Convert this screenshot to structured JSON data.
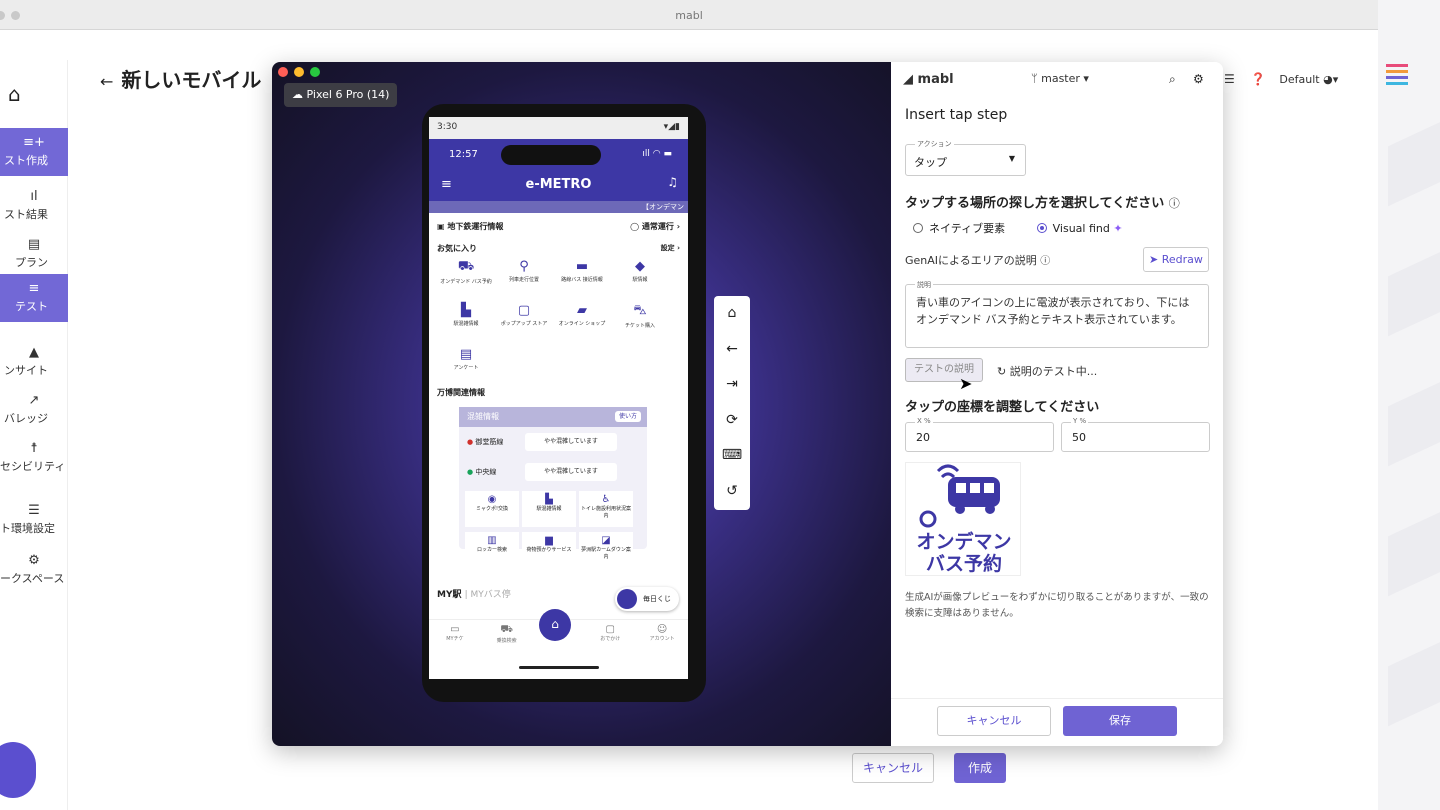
{
  "window": {
    "title": "mabl"
  },
  "leftnav": {
    "items": [
      {
        "label": "スト作成",
        "icon": "add-list-icon",
        "active": true
      },
      {
        "label": "スト結果",
        "icon": "bar-chart-icon",
        "active": false
      },
      {
        "label": "プラン",
        "icon": "calendar-icon",
        "active": false
      },
      {
        "label": "テスト",
        "icon": "list-icon",
        "active": true
      },
      {
        "label": "ンサイト",
        "icon": "bell-icon",
        "active": false
      },
      {
        "label": "バレッジ",
        "icon": "trend-icon",
        "active": false
      },
      {
        "label": "セシビリティ",
        "icon": "accessibility-icon",
        "active": false
      },
      {
        "label": "ト環境設定",
        "icon": "sliders-icon",
        "active": false
      },
      {
        "label": "ークスペース",
        "icon": "gear-icon",
        "active": false
      }
    ]
  },
  "page": {
    "title": "新しいモバイル",
    "cancel_label": "キャンセル",
    "create_label": "作成"
  },
  "emulator": {
    "device_label": "Pixel 6 Pro (14)",
    "phone": {
      "status_time": "3:30",
      "inner_time": "12:57",
      "logo": "-METRO",
      "ticker": "【オンデマン",
      "subway_info": "地下鉄運行情報",
      "normal_op": "通常運行",
      "favorites": "お気に入り",
      "settings": "設定",
      "grid": [
        "オンデマンド バス予約",
        "列車走行位置",
        "路線バス 接近情報",
        "駅情報",
        "駅混雑情報",
        "ポップアップ ストア",
        "オンライン ショップ",
        "チケット購入",
        "アンケート"
      ],
      "expo": "万博関連情報",
      "crowd_title": "混雑情報",
      "crowd_howto": "使い方",
      "lines": [
        {
          "name": "御堂筋線",
          "status": "やや混雑しています"
        },
        {
          "name": "中央線",
          "status": "やや混雑しています"
        }
      ],
      "tiles": [
        "ミャクポ!交換",
        "駅混雑情報",
        "トイレ施設利用状況案内",
        "ロッカー検索",
        "荷物預かりサービス",
        "夢洲駅カームダウン案内"
      ],
      "my_station": "MY駅",
      "my_bus": "MYバス停",
      "mainichi": "毎日くじ",
      "tabs": [
        "MYチケ",
        "乗換検索",
        "ホーム",
        "おでかけ",
        "アカウント"
      ]
    }
  },
  "panel": {
    "brand": "mabl",
    "branch": "master",
    "env": "Default",
    "title": "Insert tap step",
    "action_label": "アクション",
    "action_value": "タップ",
    "find_heading": "タップする場所の探し方を選択してください",
    "radio_native": "ネイティブ要素",
    "radio_visual": "Visual find",
    "genai_label": "GenAIによるエリアの説明",
    "redraw": "Redraw",
    "desc_label": "説明",
    "desc_text": "青い車のアイコンの上に電波が表示されており、下にはオンデマンド バス予約とテキスト表示されています。",
    "test_btn": "テストの説明",
    "testing": "説明のテスト中...",
    "coord_heading": "タップの座標を調整してください",
    "x_label": "X %",
    "x_value": "20",
    "y_label": "Y %",
    "y_value": "50",
    "preview_line1": "オンデマン",
    "preview_line2": "バス予約",
    "note": "生成AIが画像プレビューをわずかに切り取ることがありますが、一致の検索に支障はありません。",
    "cancel": "キャンセル",
    "save": "保存"
  }
}
